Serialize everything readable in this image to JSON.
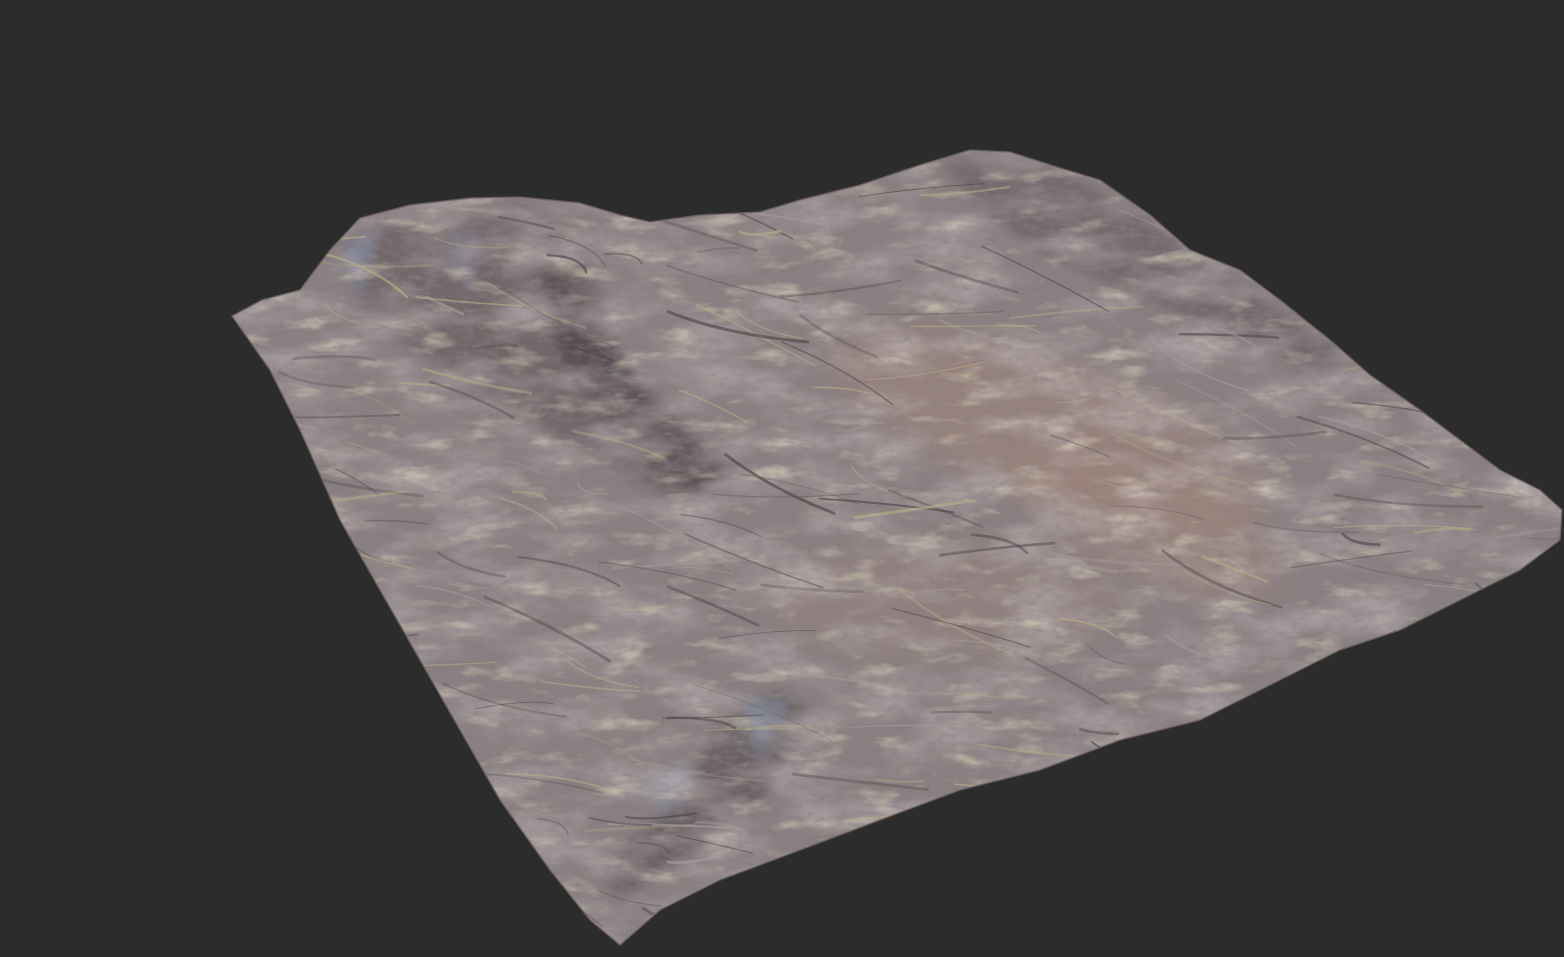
{
  "viewport": {
    "background_color": "#2c2c2c",
    "content": "terrain-mesh"
  },
  "terrain": {
    "palette": {
      "base": "#8a7f80",
      "sand": "#9c8678",
      "rock_dark": "#5e5558",
      "rock_light": "#a69b9c",
      "ochre": "#b9ad86",
      "blue_highlight": "#8fa6c8",
      "shadow": "#4a4347"
    }
  }
}
